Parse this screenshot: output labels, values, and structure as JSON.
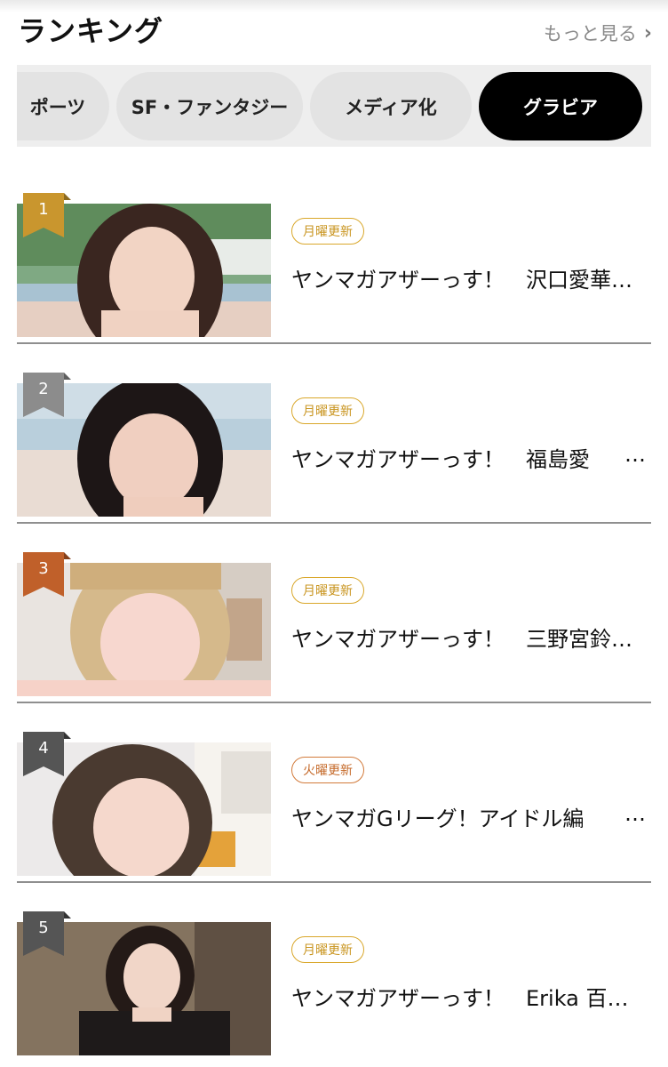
{
  "header": {
    "title": "ランキング",
    "more_label": "もっと見る"
  },
  "tabs": [
    {
      "label": "ポーツ",
      "active": false
    },
    {
      "label": "SF・ファンタジー",
      "active": false
    },
    {
      "label": "メディア化",
      "active": false
    },
    {
      "label": "グラビア",
      "active": true
    }
  ],
  "colors": {
    "rank_1": "#c9962e",
    "rank_2": "#8c8c8c",
    "rank_3": "#c0602a",
    "rank_other": "#555555",
    "badge_monday": "#d9a72a",
    "badge_tuesday": "#d27a3a",
    "active_tab": "#000000"
  },
  "ranking": [
    {
      "rank": "1",
      "badge": "月曜更新",
      "title": "ヤンマガアザーっす！　沢口愛華",
      "ellipsis": "…"
    },
    {
      "rank": "2",
      "badge": "月曜更新",
      "title": "ヤンマガアザーっす！　福島愛",
      "ellipsis": "…"
    },
    {
      "rank": "3",
      "badge": "月曜更新",
      "title": "ヤンマガアザーっす！　三野宮鈴",
      "ellipsis": "…"
    },
    {
      "rank": "4",
      "badge": "火曜更新",
      "title": "ヤンマガGリーグ！アイドル編",
      "ellipsis": "…"
    },
    {
      "rank": "5",
      "badge": "月曜更新",
      "title": "ヤンマガアザーっす！　Erika 百",
      "ellipsis": "…"
    }
  ]
}
